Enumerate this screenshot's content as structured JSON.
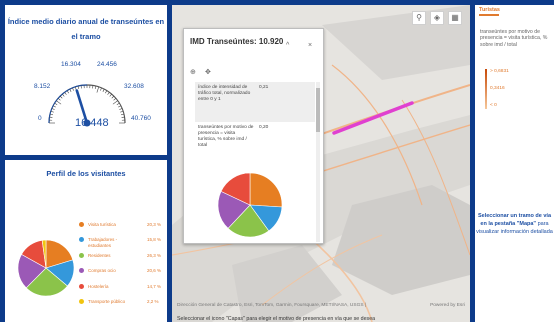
{
  "gauge": {
    "title": "Índice medio diario anual de transeúntes en el tramo",
    "ticks": [
      "8.152",
      "16.304",
      "24.456",
      "32.608",
      "40.760"
    ],
    "min_label": "0",
    "value": "16.448",
    "value_fraction": 0.4035
  },
  "profile": {
    "title": "Perfil de los visitantes",
    "items": [
      {
        "name": "Visita turística",
        "value": "20,3 %",
        "color": "#e67e22"
      },
      {
        "name": "Trabajadores - estudiantes",
        "value": "15,8 %",
        "color": "#3498db"
      },
      {
        "name": "Residentes",
        "value": "26,3 %",
        "color": "#8bc34a"
      },
      {
        "name": "Compras ocio",
        "value": "20,6 %",
        "color": "#9b59b6"
      },
      {
        "name": "Hostelería",
        "value": "14,7 %",
        "color": "#e74c3c"
      },
      {
        "name": "Transporte público",
        "value": "2,2 %",
        "color": "#f1c40f"
      }
    ]
  },
  "popup": {
    "title": "IMD Transeúntes: 10.920",
    "minimize": "^",
    "close": "×",
    "zoom_icon": "zoom-icon",
    "move_icon": "move-icon",
    "rows": [
      {
        "label": "índice de intensidad de tráfico total, normalizado entre 0 y 1",
        "value": "0,21"
      },
      {
        "label": "transeúntes por motivo de presencia = visita turística, % sobre imd / total",
        "value": "0,20"
      }
    ],
    "pie_colors": [
      "#e67e22",
      "#3498db",
      "#8bc34a",
      "#9b59b6",
      "#e74c3c"
    ]
  },
  "map": {
    "attribution": "Dirección General de Catastro, Esri, TomTom, Garmin, Foursquare, METI/NASA, USGS |",
    "powered": "Powered by Esri",
    "bottom_message": "Seleccionar el icono \"Capas\" para elegir el motivo de presencia en vía que se desea",
    "tools": [
      "search-icon",
      "layers-icon",
      "grid-icon"
    ]
  },
  "right": {
    "title": "Turistas",
    "description": "transeúntes por motivo de presencia = visita turística, % sobre imd / total",
    "legend": [
      "> 0,6831",
      "0,3416",
      "< 0"
    ],
    "select_bold": "Seleccionar un tramo de vía en la pestaña \"Mapa\"",
    "select_rest": "para visualizar información detallada"
  },
  "colors": {
    "brand_blue": "#1d4fa3",
    "background": "#0d3b8a",
    "accent_orange": "#e07a2e",
    "highlight_magenta": "#e040d0"
  }
}
